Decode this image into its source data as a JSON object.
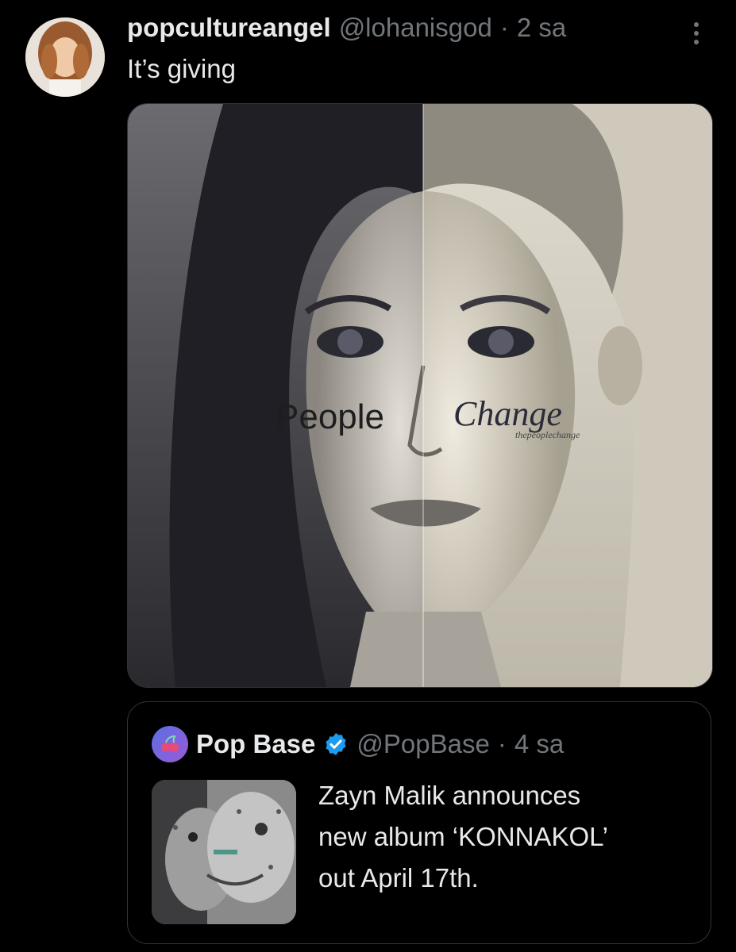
{
  "tweet": {
    "display_name": "popcultureangel",
    "handle": "@lohanisgod",
    "separator": "·",
    "time": "2 sa",
    "text": "It’s giving",
    "media": {
      "caption_left": "People",
      "caption_right": "Change",
      "watermark": "thepeoplechange"
    }
  },
  "quoted_tweet": {
    "display_name": "Pop Base",
    "handle": "@PopBase",
    "separator": "·",
    "time": "4 sa",
    "text_lines": [
      "Zayn Malik announces",
      "new album ‘KONNAKOL’",
      "out April 17th."
    ],
    "verified": true
  },
  "colors": {
    "background": "#000000",
    "primary_text": "#e7e9ea",
    "secondary_text": "#71767b",
    "border": "#2f3336",
    "verified_blue": "#1d9bf0"
  },
  "icons": [
    "more-options-icon",
    "verified-badge-icon"
  ]
}
